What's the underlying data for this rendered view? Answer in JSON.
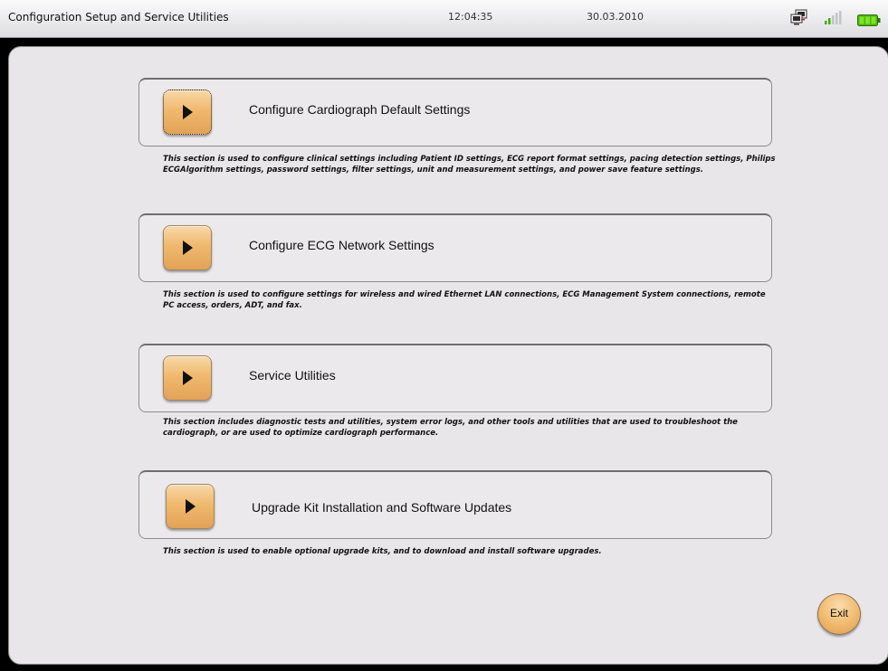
{
  "titlebar": {
    "title": "Configuration Setup and Service Utilities",
    "time": "12:04:35",
    "date": "30.03.2010",
    "icons": [
      "network-icon",
      "signal-strength-icon",
      "battery-icon"
    ]
  },
  "colors": {
    "button_orange": "#f0b96e",
    "panel_background": "#e8e6e9",
    "titlebar_background": "#e9e9ec",
    "battery_green": "#5fd000"
  },
  "sections": [
    {
      "label": "Configure Cardiograph Default Settings",
      "description": "This section is used to configure clinical settings including Patient ID settings, ECG report format settings, pacing detection settings, Philips ECGAlgorithm settings, password settings, filter settings, unit and measurement settings, and power save feature settings."
    },
    {
      "label": "Configure ECG Network Settings",
      "description": "This section is used to configure settings for wireless and wired Ethernet LAN connections, ECG Management System connections, remote PC access, orders, ADT, and fax."
    },
    {
      "label": "Service Utilities",
      "description": "This section includes diagnostic tests and utilities, system error logs, and other tools and utilities that are used to troubleshoot the cardiograph, or are used to optimize cardiograph performance."
    },
    {
      "label": "Upgrade Kit Installation and Software Updates",
      "description": "This section is used to enable optional upgrade kits, and to download and install software upgrades."
    }
  ],
  "exit_label": "Exit"
}
